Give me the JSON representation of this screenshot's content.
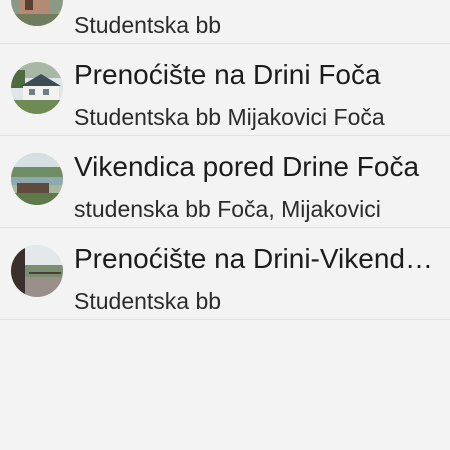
{
  "list": {
    "items": [
      {
        "title": "",
        "subtitle": "Studentska bb",
        "avatar": "cabin-photo-thumbnail"
      },
      {
        "title": "Prenoćište na Drini Foča",
        "subtitle": "Studentska bb Mijakovici Foča",
        "avatar": "house-by-river-thumbnail"
      },
      {
        "title": "Vikendica pored Drine Foča",
        "subtitle": "studenska bb Foča, Mijakovici",
        "avatar": "river-terrace-thumbnail"
      },
      {
        "title": "Prenoćište na Drini-Vikendica",
        "subtitle": "Studentska bb",
        "avatar": "balcony-view-thumbnail"
      }
    ]
  }
}
